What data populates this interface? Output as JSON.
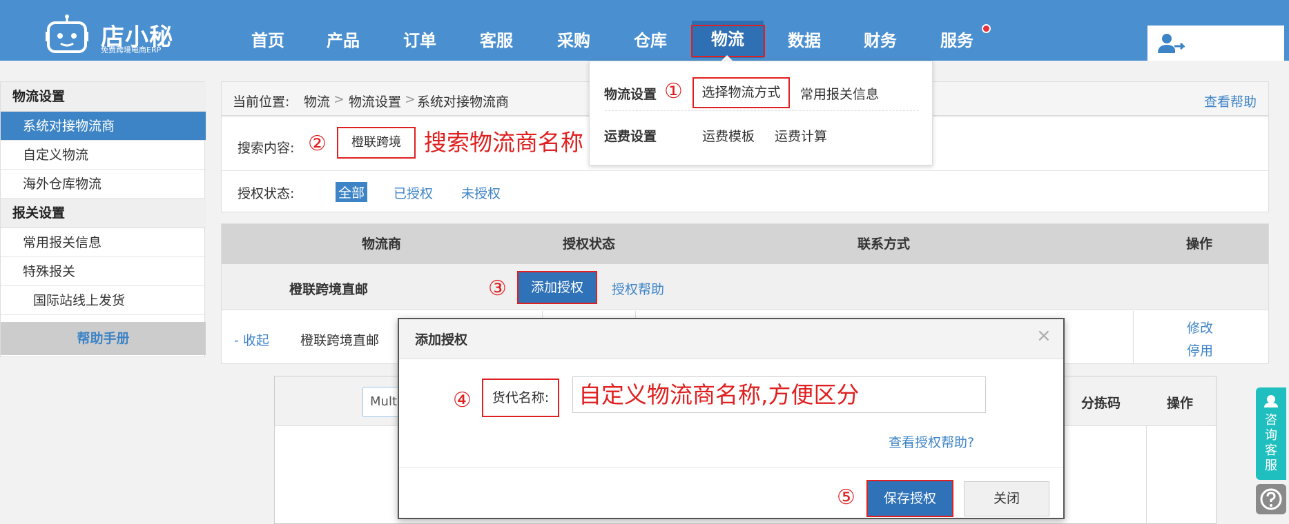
{
  "header": {
    "logo_name": "店小秘",
    "logo_sub": "免费跨境电商ERP",
    "nav": [
      {
        "label": "首页"
      },
      {
        "label": "产品"
      },
      {
        "label": "订单"
      },
      {
        "label": "客服"
      },
      {
        "label": "采购"
      },
      {
        "label": "仓库"
      },
      {
        "label": "物流"
      },
      {
        "label": "数据"
      },
      {
        "label": "财务"
      },
      {
        "label": "服务"
      }
    ],
    "active_nav": "物流",
    "accent": "#4a8fd0"
  },
  "dropdown": {
    "row1_title": "物流设置",
    "row1_items": [
      "选择物流方式",
      "常用报关信息"
    ],
    "row2_title": "运费设置",
    "row2_items": [
      "运费模板",
      "运费计算"
    ]
  },
  "sidebar": {
    "section1": "物流设置",
    "items1": [
      "系统对接物流商",
      "自定义物流",
      "海外仓库物流"
    ],
    "section2": "报关设置",
    "items2": [
      "常用报关信息",
      "特殊报关",
      "国际站线上发货"
    ],
    "help": "帮助手册"
  },
  "breadcrumb": {
    "prefix": "当前位置:",
    "parts": [
      "物流",
      "物流设置",
      "系统对接物流商"
    ],
    "sep": ">",
    "help_link": "查看帮助"
  },
  "filters": {
    "search_label": "搜索内容:",
    "search_value": "橙联跨境",
    "auth_label": "授权状态:",
    "auth_options": [
      "全部",
      "已授权",
      "未授权"
    ],
    "auth_selected": "全部"
  },
  "table": {
    "columns": [
      "物流商",
      "授权状态",
      "联系方式",
      "操作"
    ],
    "row_name": "橙联跨境直邮",
    "add_auth_button": "添加授权",
    "auth_help_link": "授权帮助",
    "collapse_link": "- 收起",
    "sub_name": "橙联跨境直邮",
    "row_actions": [
      "修改",
      "停用"
    ]
  },
  "subtable": {
    "input_value": "Multi-",
    "columns": [
      "分拣码",
      "操作"
    ]
  },
  "modal": {
    "title": "添加授权",
    "close": "×",
    "field_label": "货代名称:",
    "field_value": "自定义物流商名称,方便区分",
    "help_link": "查看授权帮助?",
    "save_button": "保存授权",
    "close_button": "关闭"
  },
  "annotations": {
    "steps": [
      "①",
      "②",
      "③",
      "④",
      "⑤"
    ],
    "search_note": "搜索物流商名称",
    "color": "#e02020"
  },
  "float": {
    "consult": "咨询客服",
    "help_icon": "question-icon"
  }
}
